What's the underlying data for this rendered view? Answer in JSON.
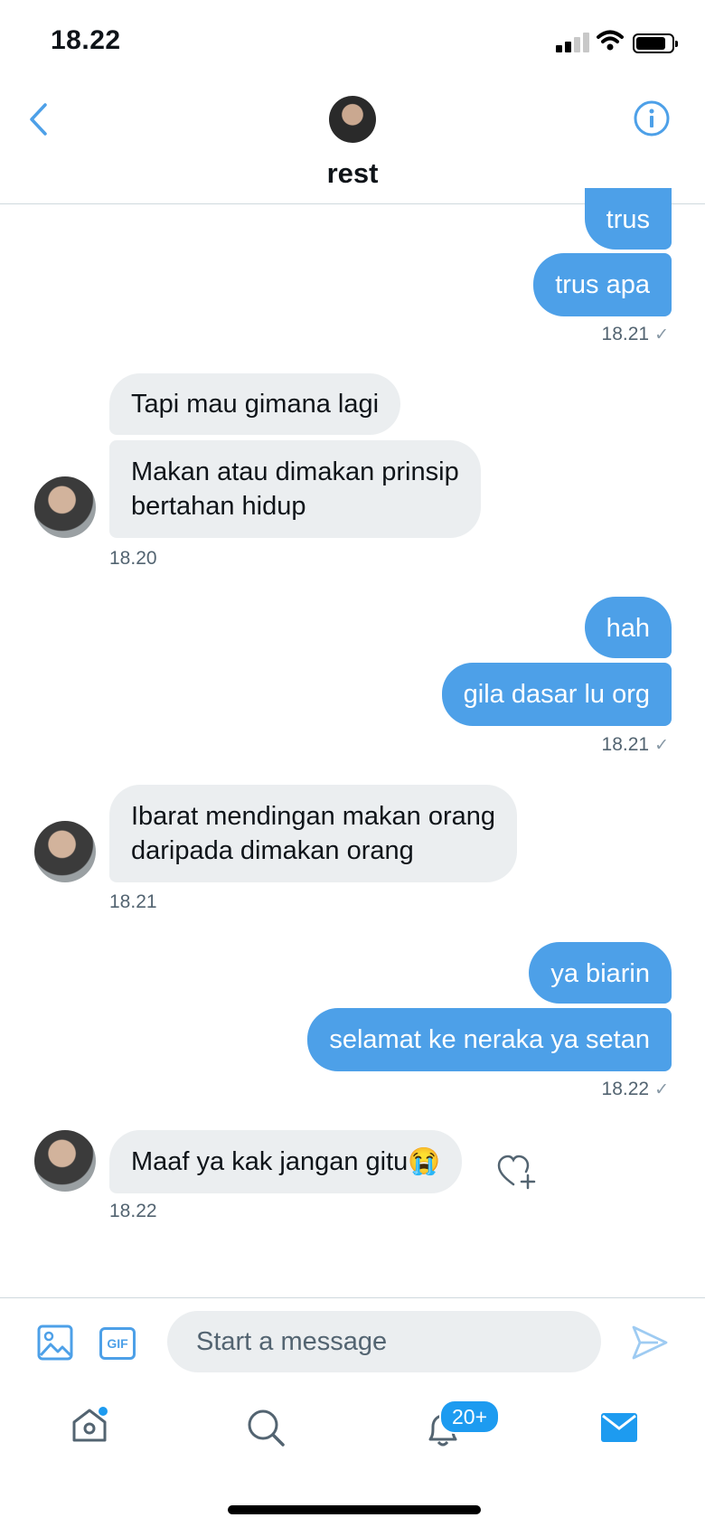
{
  "status_bar": {
    "time": "18.22"
  },
  "header": {
    "contact_name": "rest"
  },
  "messages": [
    {
      "text": "trus"
    },
    {
      "text": "trus apa"
    },
    {
      "timestamp": "18.21"
    },
    {
      "text": "Tapi mau gimana lagi"
    },
    {
      "text": "Makan atau dimakan prinsip\nbertahan hidup"
    },
    {
      "timestamp": "18.20"
    },
    {
      "text": "hah"
    },
    {
      "text": "gila dasar lu org"
    },
    {
      "timestamp": "18.21"
    },
    {
      "text": "Ibarat mendingan makan orang\ndaripada dimakan orang"
    },
    {
      "timestamp": "18.21"
    },
    {
      "text": "ya biarin"
    },
    {
      "text": "selamat ke neraka ya setan"
    },
    {
      "timestamp": "18.22"
    },
    {
      "text": "Maaf ya kak jangan gitu😭"
    },
    {
      "timestamp": "18.22"
    }
  ],
  "composer": {
    "placeholder": "Start a message",
    "gif_label": "GIF"
  },
  "bottom_nav": {
    "notifications_badge": "20+"
  },
  "colors": {
    "accent": "#4da0e8",
    "incoming_bubble": "#ebeef0",
    "badge": "#1d9bf0"
  },
  "icons": [
    "signal-icon",
    "wifi-icon",
    "battery-icon",
    "back-icon",
    "info-icon",
    "heart-add-icon",
    "image-icon",
    "gif-icon",
    "send-icon",
    "home-icon",
    "search-icon",
    "bell-icon",
    "mail-icon"
  ]
}
